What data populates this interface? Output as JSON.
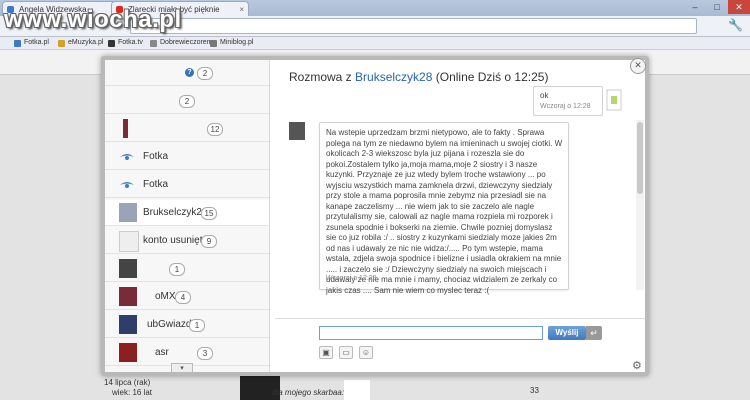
{
  "browser": {
    "tabs": [
      {
        "label": "Angela Widzewska - ",
        "favicon_color": "#3b79c9"
      },
      {
        "label": "Zlarecki miało być pięknie",
        "favicon_color": "#d92b1e"
      }
    ],
    "window_controls": {
      "minimize": "–",
      "maximize": "□",
      "close": "✕"
    },
    "bookmarks": [
      {
        "label": "Fotka.pl",
        "icon_color": "#3b79c9"
      },
      {
        "label": "eMuzyka.pl",
        "icon_color": "#d7a02a"
      },
      {
        "label": "Fotka.tv",
        "icon_color": "#333333"
      },
      {
        "label": "Dobrewieczorem",
        "icon_color": "#888888"
      },
      {
        "label": "Miniblog.pl",
        "icon_color": "#777777"
      }
    ]
  },
  "watermark": "www.wiocha.pl",
  "page_background": {
    "profile_line1": "14 lipca (rak)",
    "profile_line2": "wiek: 16 lat",
    "caption": "dla mojego skarbaa:*",
    "count": "33"
  },
  "chat": {
    "close_icon": "✕",
    "header_prefix": "Rozmowa z ",
    "header_user": "Brukselczyk28",
    "header_status": " (Online Dziś o 12:25)",
    "contacts": [
      {
        "name": "",
        "badge": "2",
        "kind": "help"
      },
      {
        "name": "",
        "badge": "2",
        "kind": "blank"
      },
      {
        "name": "",
        "badge": "12",
        "kind": "photo"
      },
      {
        "name": "Fotka",
        "badge": "",
        "kind": "eye"
      },
      {
        "name": "Fotka",
        "badge": "",
        "kind": "eye"
      },
      {
        "name": "Brukselczyk28",
        "badge": "15",
        "kind": "photo",
        "active": true
      },
      {
        "name": "konto usunięte",
        "badge": "9",
        "kind": "deleted"
      },
      {
        "name": "",
        "badge": "1",
        "kind": "photo"
      },
      {
        "name": "oMX",
        "badge": "4",
        "kind": "photo"
      },
      {
        "name": "ubGwiazd",
        "badge": "1",
        "kind": "photo"
      },
      {
        "name": "asr",
        "badge": "3",
        "kind": "photo"
      }
    ],
    "outgoing": {
      "text": "ok",
      "time": "Wczoraj o 12:28"
    },
    "incoming": {
      "text": "Na wstepie uprzedzam brzmi nietypowo, ale to fakty . Sprawa polega na tym ze niedawno bylem na imieninach u swojej ciotki. W okolicach 2-3 wiekszosc byla juz pijana i rozeszla sie do pokoi.Zostalem tylko ja,moja mama,moje 2 siostry i 3 nasze kuzynki. Przyznaje ze juz wtedy bylem troche wstawiony ... po wyjsciu wszystkich mama zamknela drzwi, dziewczyny siedzialy przy stole a mama poprosila mnie zebymz nia przesiadl sie na kanape zaczelismy ... nie wiem jak to sie zaczelo ale nagle przytulalismy sie, calowali az nagle mama rozpiela mi rozporek i zsunela spodnie i bokserki na ziemie. Chwile pozniej domyslasz sie co juz robila :/ .. siostry z kuzynkami siedzialy moze jakies 2m od nas i udawaly ze nic nie widza:/..... Po tym wstepie, mama wstala, zdjela swoja spodnice i bielizne i usiadla okrakiem na mnie ..... i zaczelo sie :/ Dziewczyny siedzialy na swoich miejscach i udawaly ze nie ma mnie i mamy, chociaz widzialem ze zerkaly co jakis czas .... Sam nie wiem co myslec teraz :(",
      "time": "Wczoraj o 12:29"
    },
    "input": {
      "value": "",
      "placeholder": ""
    },
    "send_label": "Wyślij",
    "enter_icon": "↵",
    "tools": [
      {
        "name": "image-icon",
        "glyph": "▣"
      },
      {
        "name": "speech-bubble-icon",
        "glyph": "▭"
      },
      {
        "name": "smiley-icon",
        "glyph": "☺"
      }
    ],
    "scroll_down_icon": "▾",
    "settings_icon": "⚙"
  },
  "colors": {
    "accent": "#2a63b0",
    "send_button": "#4a84c6",
    "eye": "#3a7fc4"
  }
}
